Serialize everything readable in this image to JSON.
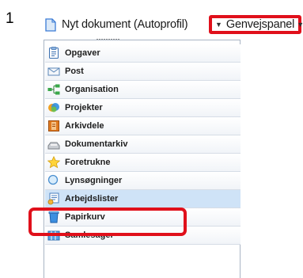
{
  "step_number": "1",
  "toolbar": {
    "new_document_label": "Nyt dokument (Autoprofil)",
    "shortcut_panel_label": "Genvejspanel"
  },
  "menu": {
    "items": [
      {
        "label": "Opgaver",
        "icon": "task-list-icon"
      },
      {
        "label": "Post",
        "icon": "mail-envelope-icon"
      },
      {
        "label": "Organisation",
        "icon": "org-chart-icon"
      },
      {
        "label": "Projekter",
        "icon": "projects-globe-icon"
      },
      {
        "label": "Arkivdele",
        "icon": "archive-box-icon"
      },
      {
        "label": "Dokumentarkiv",
        "icon": "document-tray-icon"
      },
      {
        "label": "Foretrukne",
        "icon": "star-icon"
      },
      {
        "label": "Lynsøgninger",
        "icon": "quick-search-icon"
      },
      {
        "label": "Arbejdslister",
        "icon": "work-list-icon"
      },
      {
        "label": "Papirkurv",
        "icon": "recycle-bin-icon"
      },
      {
        "label": "Samlesager",
        "icon": "collection-cases-icon"
      }
    ],
    "selected_label": "Arbejdslister"
  },
  "colors": {
    "highlight": "#e0101b",
    "selected_row": "#cfe3f7",
    "border": "#a9b5c4"
  }
}
